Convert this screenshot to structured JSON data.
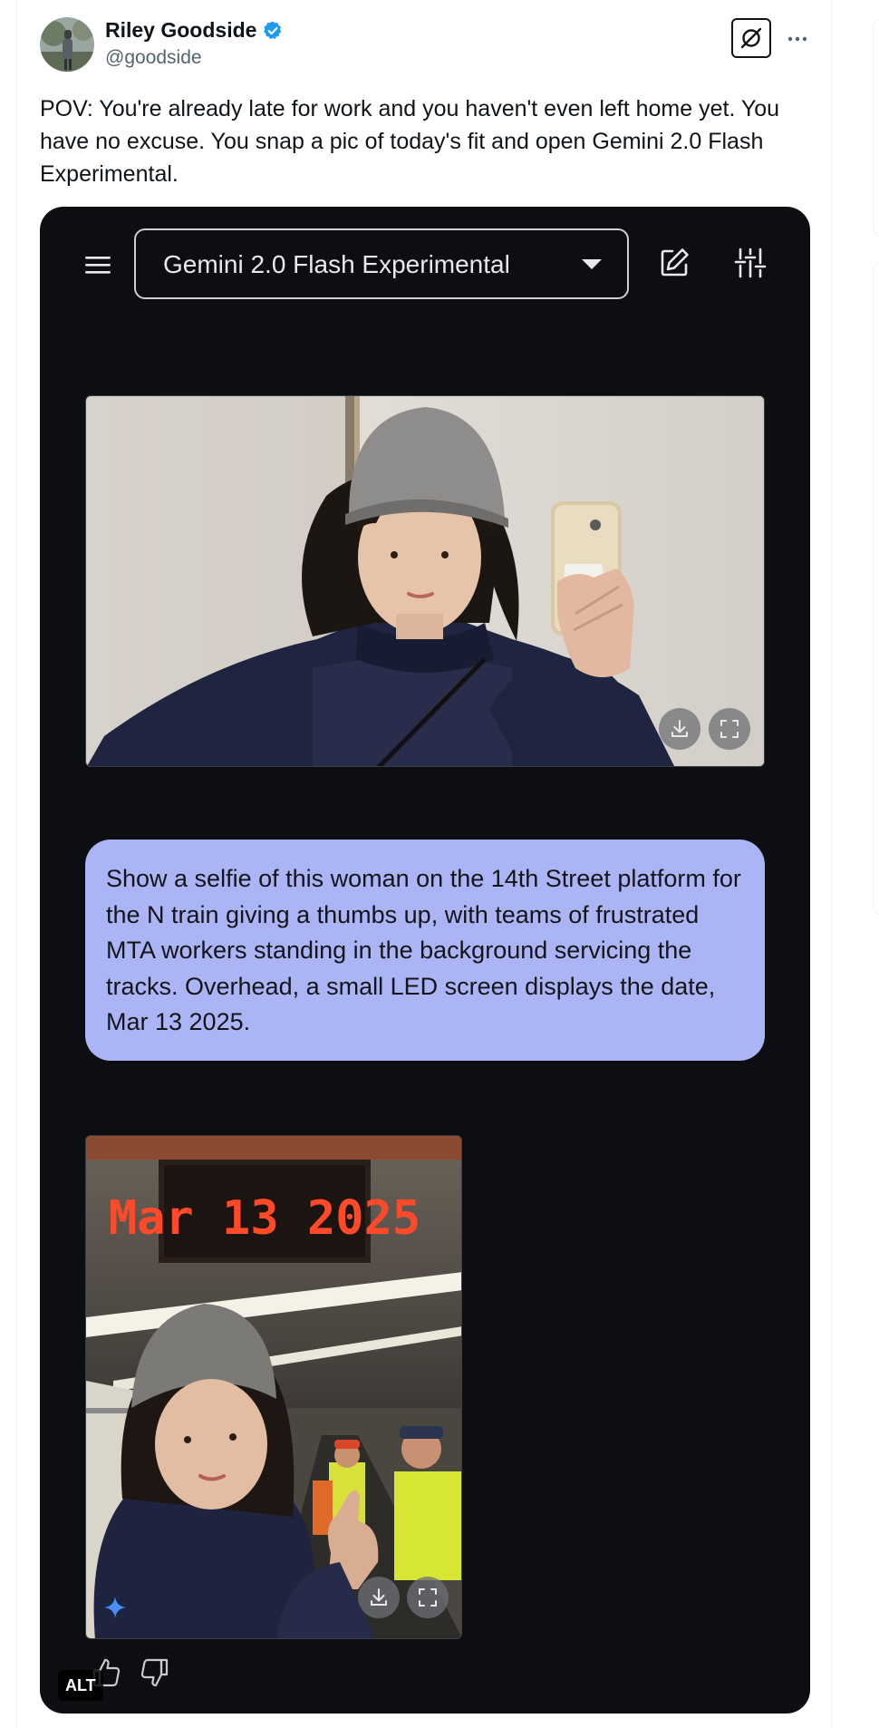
{
  "author": {
    "display_name": "Riley Goodside",
    "handle": "@goodside",
    "verified": true
  },
  "tweet": {
    "text": "POV: You're already late for work and you haven't even left home yet. You have no excuse. You snap a pic of today's fit and open Gemini 2.0 Flash Experimental."
  },
  "gemini_ui": {
    "model_selector": "Gemini 2.0 Flash Experimental",
    "prompt": "Show a selfie of this woman on the 14th Street platform for the N train giving a thumbs up, with teams of frustrated MTA workers standing in the background servicing the tracks. Overhead, a small LED screen displays the date, Mar 13 2025.",
    "generated_sign_text": "Mar 13 2025"
  },
  "media_badge": "ALT",
  "icons": {
    "verified": "verified-badge-icon",
    "grok": "grok-icon",
    "more": "more-icon",
    "menu": "hamburger-menu-icon",
    "edit": "new-chat-icon",
    "tune": "tune-icon",
    "download": "download-icon",
    "fullscreen": "fullscreen-icon",
    "sparkle": "gemini-sparkle-icon",
    "thumbs_up": "thumbs-up-icon",
    "thumbs_down": "thumbs-down-icon"
  },
  "colors": {
    "verified_blue": "#1d9bf0",
    "panel_bg": "#0d0e12",
    "prompt_bubble": "#abb5f5",
    "led_red": "#ff4a2a",
    "sparkle_blue": "#4a8ef5"
  }
}
